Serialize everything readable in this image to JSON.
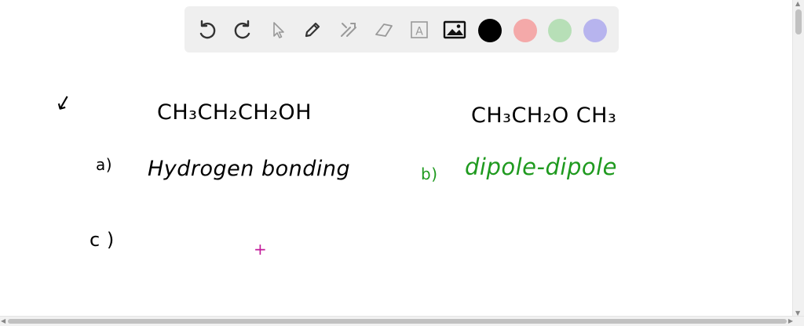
{
  "toolbar": {
    "tools": [
      {
        "name": "undo-icon"
      },
      {
        "name": "redo-icon"
      },
      {
        "name": "select-pointer-icon"
      },
      {
        "name": "pen-icon"
      },
      {
        "name": "tools-icon"
      },
      {
        "name": "eraser-icon"
      },
      {
        "name": "text-box-icon",
        "glyph": "A"
      },
      {
        "name": "image-icon"
      }
    ],
    "colors": [
      "#000000",
      "#f4a9a9",
      "#b7dfb7",
      "#b7b4ee"
    ]
  },
  "canvas": {
    "marker": "↙",
    "formula_a": "CH₃CH₂CH₂OH",
    "formula_b": "CH₃CH₂O CH₃",
    "item_a_label": "a)",
    "item_a_text": "Hydrogen bonding",
    "item_b_label": "b)",
    "item_b_text": "dipole-dipole",
    "item_c_label": "c )",
    "cursor": "+",
    "ink_color": "#000000",
    "green_ink": "#1f9a1f",
    "cursor_color": "#c21a9a"
  }
}
